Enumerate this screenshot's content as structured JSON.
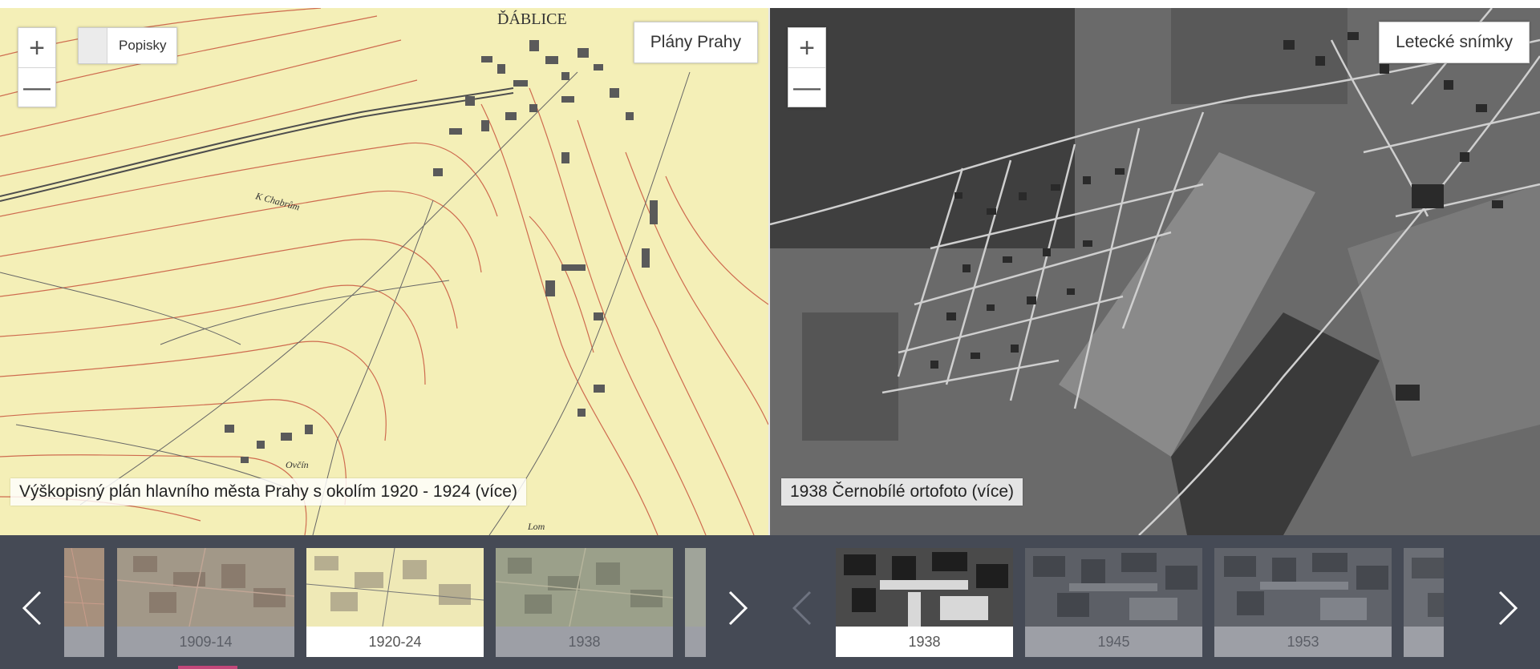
{
  "left_map": {
    "title": "Plány Prahy",
    "labels_toggle": "Popisky",
    "caption": "Výškopisný plán hlavního města Prahy s okolím 1920 - 1924 (více)",
    "place_labels": [
      "ĎÁBLICE",
      "K Chabrům",
      "Ovčín",
      "Lom"
    ],
    "zoom_in": "+",
    "zoom_out": "—",
    "colors": {
      "paper": "#f4efb7",
      "contours": "#c8553d",
      "roads": "#555555"
    }
  },
  "right_map": {
    "title": "Letecké snímky",
    "caption": "1938 Černobílé ortofoto (více)",
    "zoom_in": "+",
    "zoom_out": "—"
  },
  "left_strip": {
    "thumbnails": [
      {
        "label": "",
        "active": false
      },
      {
        "label": "1909-14",
        "active": false
      },
      {
        "label": "1920-24",
        "active": true
      },
      {
        "label": "1938",
        "active": false
      },
      {
        "label": "",
        "active": false
      }
    ],
    "prev_enabled": true,
    "next_enabled": true
  },
  "right_strip": {
    "thumbnails": [
      {
        "label": "1938",
        "active": true
      },
      {
        "label": "1945",
        "active": false
      },
      {
        "label": "1953",
        "active": false
      },
      {
        "label": "",
        "active": false
      }
    ],
    "prev_enabled": false,
    "next_enabled": true
  },
  "icons": {
    "prev": "chevron-left-icon",
    "next": "chevron-right-icon",
    "zoom_in": "plus-icon",
    "zoom_out": "minus-icon"
  },
  "accent_color": "#c3477a"
}
